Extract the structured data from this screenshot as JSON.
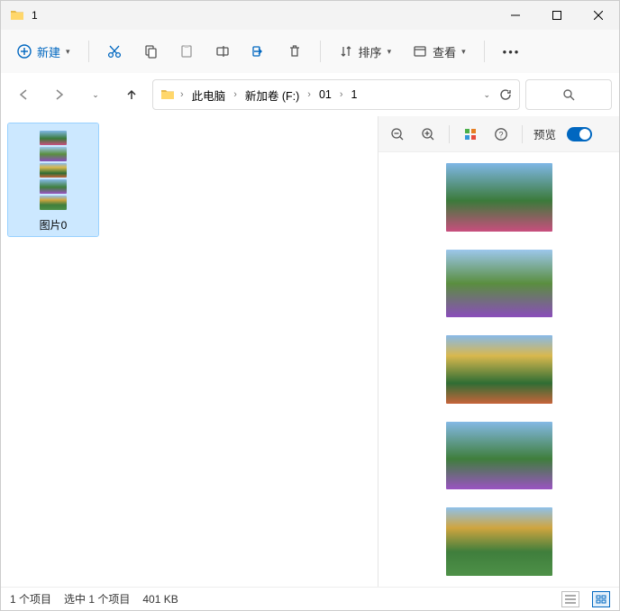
{
  "window": {
    "title": "1"
  },
  "toolbar": {
    "new_label": "新建",
    "sort_label": "排序",
    "view_label": "查看"
  },
  "breadcrumb": {
    "items": [
      "此电脑",
      "新加卷 (F:)",
      "01",
      "1"
    ]
  },
  "file": {
    "name": "图片0"
  },
  "preview": {
    "toggle_label": "预览"
  },
  "status": {
    "count": "1 个项目",
    "selected": "选中 1 个项目",
    "size": "401 KB"
  }
}
